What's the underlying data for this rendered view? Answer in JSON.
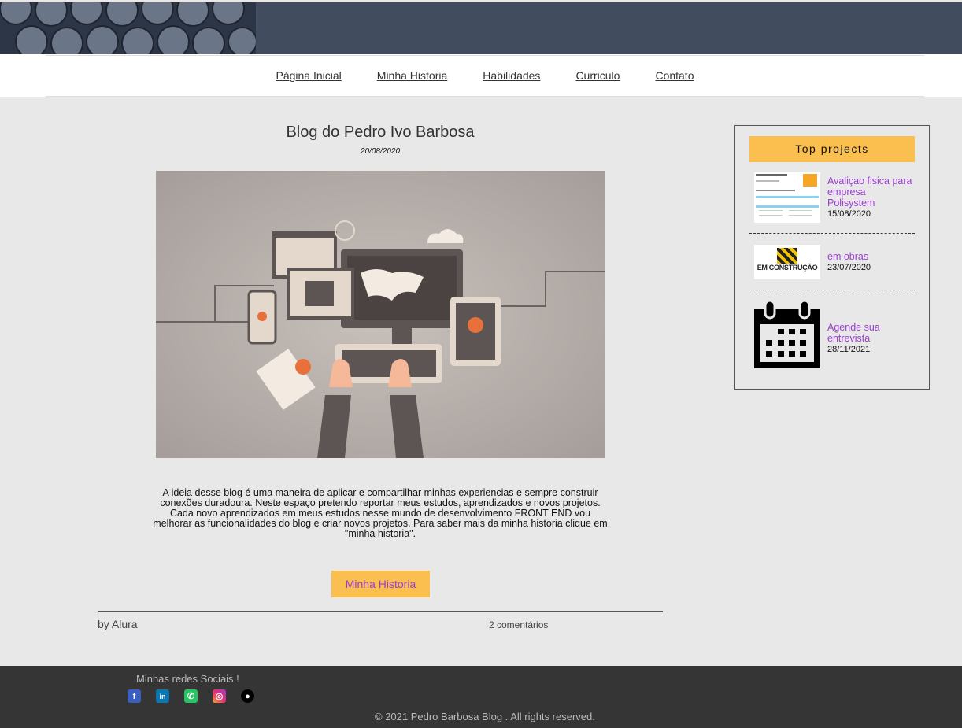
{
  "nav": {
    "items": [
      "Página Inicial",
      "Minha Historia",
      "Habilidades",
      "Curriculo",
      "Contato"
    ]
  },
  "post": {
    "title": "Blog do Pedro Ivo Barbosa",
    "date": "20/08/2020",
    "body": "A ideia desse blog é uma maneira de aplicar e compartilhar minhas experiencias e sempre construir conexões duradoura. Neste espaço pretendo reportar meus estudos, aprendizados e novos projetos. Cada novo aprendizados em meus estudos nesse mundo de desenvolvimento FRONT END vou melhorar as funcionalidades do blog e criar novos projetos. Para saber mais da minha historia clique em \"minha historia\".",
    "button": "Minha Historia",
    "author": "by Alura",
    "comments": "2 comentários"
  },
  "aside": {
    "title": "Top projects",
    "items": [
      {
        "title": "Avaliçao fisica para empresa Polisystem",
        "date": "15/08/2020"
      },
      {
        "title": "em obras",
        "date": "23/07/2020",
        "thumb_text": "EM CONSTRUÇÃO"
      },
      {
        "title": "Agende sua entrevista",
        "date": "28/11/2021"
      }
    ]
  },
  "footer": {
    "social_title": "Minhas redes Sociais !",
    "icons": [
      "facebook-icon",
      "linkedin-icon",
      "whatsapp-icon",
      "instagram-icon",
      "github-icon"
    ],
    "copyright": "© 2021 Pedro Barbosa Blog . All rights reserved."
  },
  "colors": {
    "accent": "#fbbf50",
    "link": "#9b3fd0",
    "footer": "#353535",
    "header": "#414c5e"
  }
}
